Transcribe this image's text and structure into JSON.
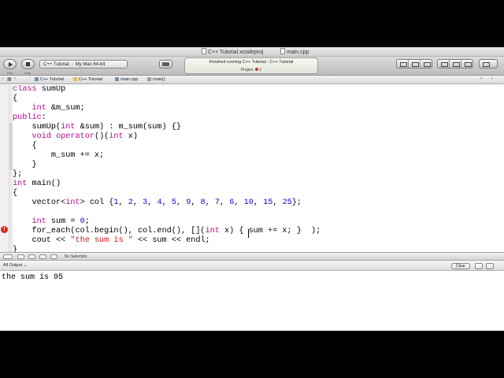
{
  "window": {
    "project_title": "C++ Tutorial.xcodeproj",
    "file_title": "main.cpp"
  },
  "toolbar": {
    "run_label": "Run",
    "stop_label": "Stop",
    "scheme_target": "C++ Tutorial",
    "scheme_device": "My Mac 64-bit",
    "activity_status": "Finished running C++ Tutorial : C++ Tutorial",
    "activity_project_label": "Project",
    "activity_issue_count": "1"
  },
  "jumpbar": {
    "items": [
      "C++ Tutorial",
      "C++ Tutorial",
      "main.cpp",
      "main()"
    ]
  },
  "editor": {
    "error_marker": "!",
    "lines": [
      [
        {
          "t": "kw",
          "v": "class"
        },
        {
          "t": "p",
          "v": " sumUp"
        }
      ],
      [
        {
          "t": "p",
          "v": "{"
        }
      ],
      [
        {
          "t": "p",
          "v": "    "
        },
        {
          "t": "kw",
          "v": "int"
        },
        {
          "t": "p",
          "v": " &m_sum;"
        }
      ],
      [
        {
          "t": "kw",
          "v": "public"
        },
        {
          "t": "p",
          "v": ":"
        }
      ],
      [
        {
          "t": "p",
          "v": "    sumUp("
        },
        {
          "t": "kw",
          "v": "int"
        },
        {
          "t": "p",
          "v": " &sum) : m_sum(sum) {}"
        }
      ],
      [
        {
          "t": "p",
          "v": "    "
        },
        {
          "t": "kw",
          "v": "void"
        },
        {
          "t": "p",
          "v": " "
        },
        {
          "t": "kw",
          "v": "operator"
        },
        {
          "t": "p",
          "v": "()("
        },
        {
          "t": "kw",
          "v": "int"
        },
        {
          "t": "p",
          "v": " x)"
        }
      ],
      [
        {
          "t": "p",
          "v": "    {"
        }
      ],
      [
        {
          "t": "p",
          "v": "        m_sum += x;"
        }
      ],
      [
        {
          "t": "p",
          "v": "    }"
        }
      ],
      [
        {
          "t": "p",
          "v": "};"
        }
      ],
      [
        {
          "t": "kw",
          "v": "int"
        },
        {
          "t": "p",
          "v": " main()"
        }
      ],
      [
        {
          "t": "p",
          "v": "{"
        }
      ],
      [
        {
          "t": "p",
          "v": "    vector<"
        },
        {
          "t": "kw",
          "v": "int"
        },
        {
          "t": "p",
          "v": "> col {"
        },
        {
          "t": "num",
          "v": "1"
        },
        {
          "t": "p",
          "v": ", "
        },
        {
          "t": "num",
          "v": "2"
        },
        {
          "t": "p",
          "v": ", "
        },
        {
          "t": "num",
          "v": "3"
        },
        {
          "t": "p",
          "v": ", "
        },
        {
          "t": "num",
          "v": "4"
        },
        {
          "t": "p",
          "v": ", "
        },
        {
          "t": "num",
          "v": "5"
        },
        {
          "t": "p",
          "v": ", "
        },
        {
          "t": "num",
          "v": "9"
        },
        {
          "t": "p",
          "v": ", "
        },
        {
          "t": "num",
          "v": "8"
        },
        {
          "t": "p",
          "v": ", "
        },
        {
          "t": "num",
          "v": "7"
        },
        {
          "t": "p",
          "v": ", "
        },
        {
          "t": "num",
          "v": "6"
        },
        {
          "t": "p",
          "v": ", "
        },
        {
          "t": "num",
          "v": "10"
        },
        {
          "t": "p",
          "v": ", "
        },
        {
          "t": "num",
          "v": "15"
        },
        {
          "t": "p",
          "v": ", "
        },
        {
          "t": "num",
          "v": "25"
        },
        {
          "t": "p",
          "v": "};"
        }
      ],
      [
        {
          "t": "p",
          "v": ""
        }
      ],
      [
        {
          "t": "p",
          "v": "    "
        },
        {
          "t": "kw",
          "v": "int"
        },
        {
          "t": "p",
          "v": " sum = "
        },
        {
          "t": "num",
          "v": "0"
        },
        {
          "t": "p",
          "v": ";"
        }
      ],
      [
        {
          "t": "p",
          "v": "    for_each(col.begin(), col.end(), []("
        },
        {
          "t": "kw",
          "v": "int"
        },
        {
          "t": "p",
          "v": " x) { sum += x; }  );"
        }
      ],
      [
        {
          "t": "p",
          "v": "    cout << "
        },
        {
          "t": "str",
          "v": "\"the sum is \""
        },
        {
          "t": "p",
          "v": " << sum << endl;"
        }
      ],
      [
        {
          "t": "p",
          "v": "}"
        }
      ]
    ]
  },
  "debugbar": {
    "selection_text": "No Selection"
  },
  "console": {
    "filter_label": "All Output",
    "clear_label": "Clear",
    "output": "the sum is 95"
  }
}
